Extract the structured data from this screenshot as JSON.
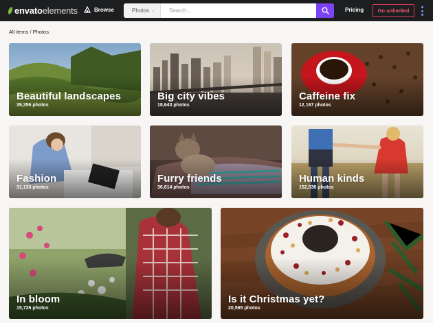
{
  "header": {
    "logo_part1": "envato",
    "logo_part2": "elements",
    "browse_label": "Browse",
    "search_category": "Photos",
    "search_placeholder": "Search...",
    "pricing_label": "Pricing",
    "cta_label": "Go unlimited"
  },
  "breadcrumb": {
    "root": "All items",
    "separator": "/",
    "current": "Photos"
  },
  "collections": [
    {
      "title": "Beautiful landscapes",
      "count": "39,356 photos"
    },
    {
      "title": "Big city vibes",
      "count": "18,643 photos"
    },
    {
      "title": "Caffeine fix",
      "count": "12,167 photos"
    },
    {
      "title": "Fashion",
      "count": "31,133 photos"
    },
    {
      "title": "Furry friends",
      "count": "36,614 photos"
    },
    {
      "title": "Human kinds",
      "count": "152,536 photos"
    },
    {
      "title": "In bloom",
      "count": "15,726 photos"
    },
    {
      "title": "Is it Christmas yet?",
      "count": "20,565 photos"
    }
  ],
  "colors": {
    "header_bg": "#1d1e20",
    "search_button": "#7b43f5",
    "cta_border": "#e03b57",
    "logo_green": "#82b541",
    "page_bg": "#f7f6f4"
  }
}
